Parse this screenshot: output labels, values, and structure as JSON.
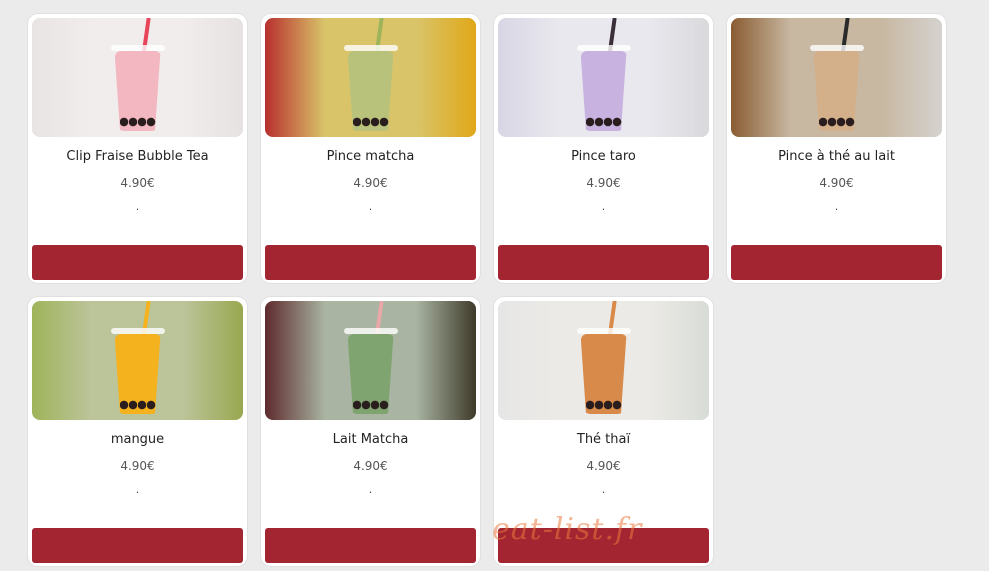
{
  "products": [
    {
      "name": "Clip Fraise Bubble Tea",
      "price": "4.90€",
      "note": ".",
      "bg_left": "#e8e4e4",
      "bg_right": "#e6e2e2",
      "bg_center": "#f1eded",
      "drink": "#f2b7c0",
      "straw": "#e8455a"
    },
    {
      "name": "Pince matcha",
      "price": "4.90€",
      "note": ".",
      "bg_left": "#b8302e",
      "bg_right": "#e0a818",
      "bg_center": "#d9c46a",
      "drink": "#b8c27a",
      "straw": "#9db45a"
    },
    {
      "name": "Pince taro",
      "price": "4.90€",
      "note": ".",
      "bg_left": "#d8d6e4",
      "bg_right": "#d9d9dc",
      "bg_center": "#e9e8ee",
      "drink": "#c7b2e0",
      "straw": "#3a2f3a"
    },
    {
      "name": "Pince à thé au lait",
      "price": "4.90€",
      "note": ".",
      "bg_left": "#8a5c32",
      "bg_right": "#d5d2cf",
      "bg_center": "#c8b8a2",
      "drink": "#d4b08a",
      "straw": "#2a2a2a"
    },
    {
      "name": "mangue",
      "price": "4.90€",
      "note": ".",
      "bg_left": "#9fb45a",
      "bg_right": "#98a84f",
      "bg_center": "#bcc49a",
      "drink": "#f4b21e",
      "straw": "#f4b21e"
    },
    {
      "name": "Lait Matcha",
      "price": "4.90€",
      "note": ".",
      "bg_left": "#5e2a2e",
      "bg_right": "#3f3a2a",
      "bg_center": "#a9b4a2",
      "drink": "#7fa470",
      "straw": "#e9a8a8"
    },
    {
      "name": "Thé thaï",
      "price": "4.90€",
      "note": ".",
      "bg_left": "#e6e6e6",
      "bg_right": "#d8dcd6",
      "bg_center": "#eceae6",
      "drink": "#d88a4a",
      "straw": "#d88a4a"
    }
  ],
  "watermark": "eat-list.fr"
}
